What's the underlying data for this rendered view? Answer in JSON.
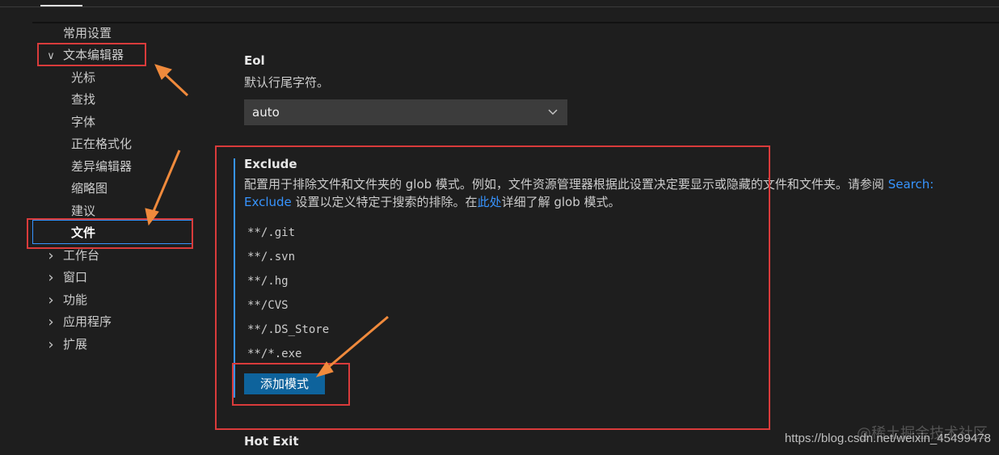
{
  "tree": {
    "items": [
      {
        "label": "常用设置"
      },
      {
        "label": "文本编辑器",
        "expanded": true
      },
      {
        "label": "光标"
      },
      {
        "label": "查找"
      },
      {
        "label": "字体"
      },
      {
        "label": "正在格式化"
      },
      {
        "label": "差异编辑器"
      },
      {
        "label": "缩略图"
      },
      {
        "label": "建议"
      },
      {
        "label": "文件",
        "selected": true
      },
      {
        "label": "工作台"
      },
      {
        "label": "窗口"
      },
      {
        "label": "功能"
      },
      {
        "label": "应用程序"
      },
      {
        "label": "扩展"
      }
    ],
    "chevron_expanded": "∨",
    "chevron_collapsed": "›"
  },
  "eol": {
    "title": "Eol",
    "description": "默认行尾字符。",
    "value": "auto"
  },
  "exclude": {
    "title": "Exclude",
    "desc_part1": "配置用于排除文件和文件夹的 glob 模式。例如，文件资源管理器根据此设置决定要显示或隐藏的文件和文件夹。请参阅 ",
    "link1": "Search:",
    "link1b": "Exclude",
    "desc_part2": " 设置以定义特定于搜索的排除。在",
    "link2": "此处",
    "desc_part3": "详细了解 glob 模式。",
    "patterns": [
      "**/.git",
      "**/.svn",
      "**/.hg",
      "**/CVS",
      "**/.DS_Store",
      "**/*.exe"
    ],
    "add_button": "添加模式"
  },
  "hot_exit": {
    "title": "Hot Exit"
  },
  "watermark": "https://blog.csdn.net/weixin_45499478",
  "watermark_logo": "@稀土掘金技术社区",
  "colors": {
    "accent": "#3794ff",
    "button": "#0e639c",
    "annotation": "#d93b3b",
    "arrow": "#f08a3c"
  }
}
